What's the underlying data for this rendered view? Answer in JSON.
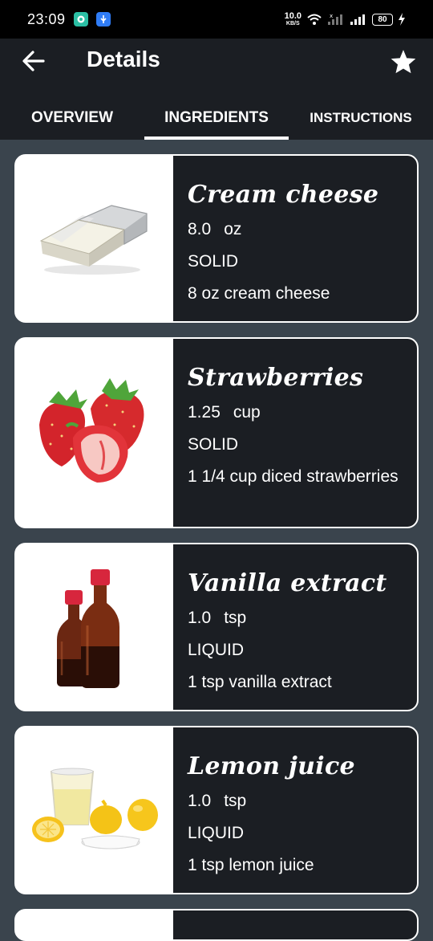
{
  "status_bar": {
    "time": "23:09",
    "net_speed_value": "10.0",
    "net_speed_unit": "KB/S",
    "battery": "80"
  },
  "app_bar": {
    "title": "Details",
    "back_icon": "arrow-left-icon",
    "favorite_icon": "star-icon"
  },
  "tabs": [
    {
      "label": "OVERVIEW",
      "selected": false
    },
    {
      "label": "INGREDIENTS",
      "selected": true
    },
    {
      "label": "INSTRUCTIONS",
      "selected": false
    }
  ],
  "ingredients": [
    {
      "name": "Cream cheese",
      "amount": "8.0",
      "unit": "oz",
      "type": "SOLID",
      "description": "8 oz cream cheese",
      "image": "cream-cheese-image"
    },
    {
      "name": "Strawberries",
      "amount": "1.25",
      "unit": "cup",
      "type": "SOLID",
      "description": "1 1/4 cup diced strawberries",
      "image": "strawberries-image"
    },
    {
      "name": "Vanilla extract",
      "amount": "1.0",
      "unit": "tsp",
      "type": "LIQUID",
      "description": "1 tsp vanilla extract",
      "image": "vanilla-extract-image"
    },
    {
      "name": "Lemon juice",
      "amount": "1.0",
      "unit": "tsp",
      "type": "LIQUID",
      "description": "1 tsp lemon juice",
      "image": "lemon-juice-image"
    }
  ],
  "colors": {
    "app_bar": "#1b1e23",
    "background": "#3a444d",
    "card_info": "#1b1e23",
    "text": "#ffffff"
  }
}
